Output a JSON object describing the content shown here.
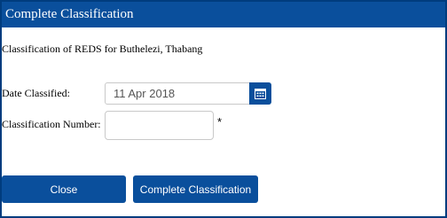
{
  "dialog": {
    "title": "Complete Classification",
    "description": "Classification of REDS for Buthelezi, Thabang"
  },
  "form": {
    "date_label": "Date Classified:",
    "date_value": "11 Apr 2018",
    "number_label": "Classification Number:",
    "number_value": "",
    "required_marker": "*"
  },
  "buttons": {
    "close_label": "Close",
    "complete_label": "Complete Classification"
  },
  "colors": {
    "accent": "#0a4f9c",
    "border": "#003c7e"
  }
}
